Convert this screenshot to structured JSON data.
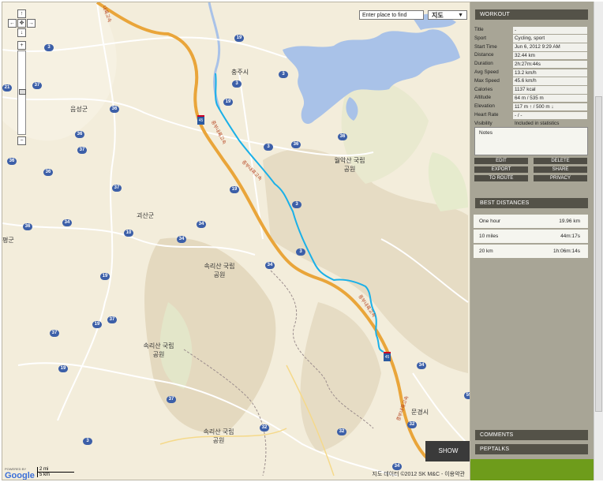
{
  "map": {
    "search_placeholder": "Enter place to find",
    "map_type": "지도",
    "show_label": "SHOW",
    "attribution": "지도 데이터 ©2012 SK M&C - 이용약관",
    "scale_mi": "2 mi",
    "scale_km": "5 km",
    "logo_powered": "POWERED BY",
    "logo_text": "Google",
    "places": {
      "chungju": "충주시",
      "eumseong": "음성군",
      "woraksan": "월악산 국립공원",
      "goesan": "괴산군",
      "songnisan1": "속리산 국립공원",
      "songnisan2": "속리산 국립공원",
      "songnisan3": "속리산 국립공원",
      "mungyeong": "문경시",
      "west": "평군",
      "highway1": "중부내륙고속",
      "highway2": "중부내륙고속",
      "highway3": "중부내륙고속",
      "highway4": "중부내륙고속",
      "highway_top": "내륙고속"
    },
    "road_numbers": {
      "r19a": "19",
      "r3a": "3",
      "r3b": "3",
      "r3c": "3",
      "r19b": "19",
      "r36a": "36",
      "r37a": "37",
      "r36b": "36",
      "r36c": "36",
      "r36d": "36",
      "r37b": "37",
      "r36e": "36",
      "r19c": "19",
      "r3d": "3",
      "r36f": "36",
      "r37c": "37",
      "r34a": "34",
      "r36g": "36",
      "r34b": "34",
      "r10": "10",
      "r34c": "34",
      "r34d": "34",
      "r3e": "3",
      "r19d": "19",
      "r37d": "37",
      "r19e": "19",
      "r37e": "37",
      "r19f": "19",
      "r21": "21",
      "r34e": "34",
      "r59": "59",
      "r37f": "37",
      "r32a": "32",
      "r32b": "32",
      "r32c": "32",
      "r3f": "3",
      "r45a": "45",
      "r45b": "45",
      "r3g": "3",
      "r34f": "34"
    }
  },
  "workout": {
    "header": "WORKOUT",
    "stats": [
      {
        "label": "Title",
        "value": "-"
      },
      {
        "label": "Sport",
        "value": "Cycling, sport"
      },
      {
        "label": "Start Time",
        "value": "Jun 6, 2012 9:29 AM"
      },
      {
        "label": "Distance",
        "value": "32.44 km"
      },
      {
        "label": "Duration",
        "value": "2h:27m:44s"
      },
      {
        "label": "Avg Speed",
        "value": "13.2 km/h"
      },
      {
        "label": "Max Speed",
        "value": "45.6 km/h"
      },
      {
        "label": "Calories",
        "value": "1137 kcal"
      },
      {
        "label": "Altitude",
        "value": "64 m / 535 m"
      },
      {
        "label": "Elevation",
        "value": "117 m ↑ / 500 m ↓"
      },
      {
        "label": "Heart Rate",
        "value": "- / -"
      },
      {
        "label": "Visibility",
        "value": "Included in statistics"
      }
    ],
    "notes_label": "Notes",
    "buttons": {
      "edit": "EDIT",
      "delete": "DELETE",
      "export": "EXPORT",
      "share": "SHARE",
      "to_route": "TO ROUTE",
      "privacy": "PRIVACY"
    }
  },
  "best": {
    "header": "BEST DISTANCES",
    "rows": [
      {
        "label": "One hour",
        "value": "19.96 km"
      },
      {
        "label": "10 miles",
        "value": "44m:17s"
      },
      {
        "label": "20 km",
        "value": "1h:06m:14s"
      }
    ]
  },
  "comments_label": "COMMENTS",
  "peptalks_label": "PEPTALKS",
  "colors": {
    "route": "#1ab0e8",
    "highway": "#e9a53a",
    "water": "#a9c2e8",
    "panel": "#a8a596",
    "header": "#545248",
    "footer_green": "#6e9c1b"
  }
}
